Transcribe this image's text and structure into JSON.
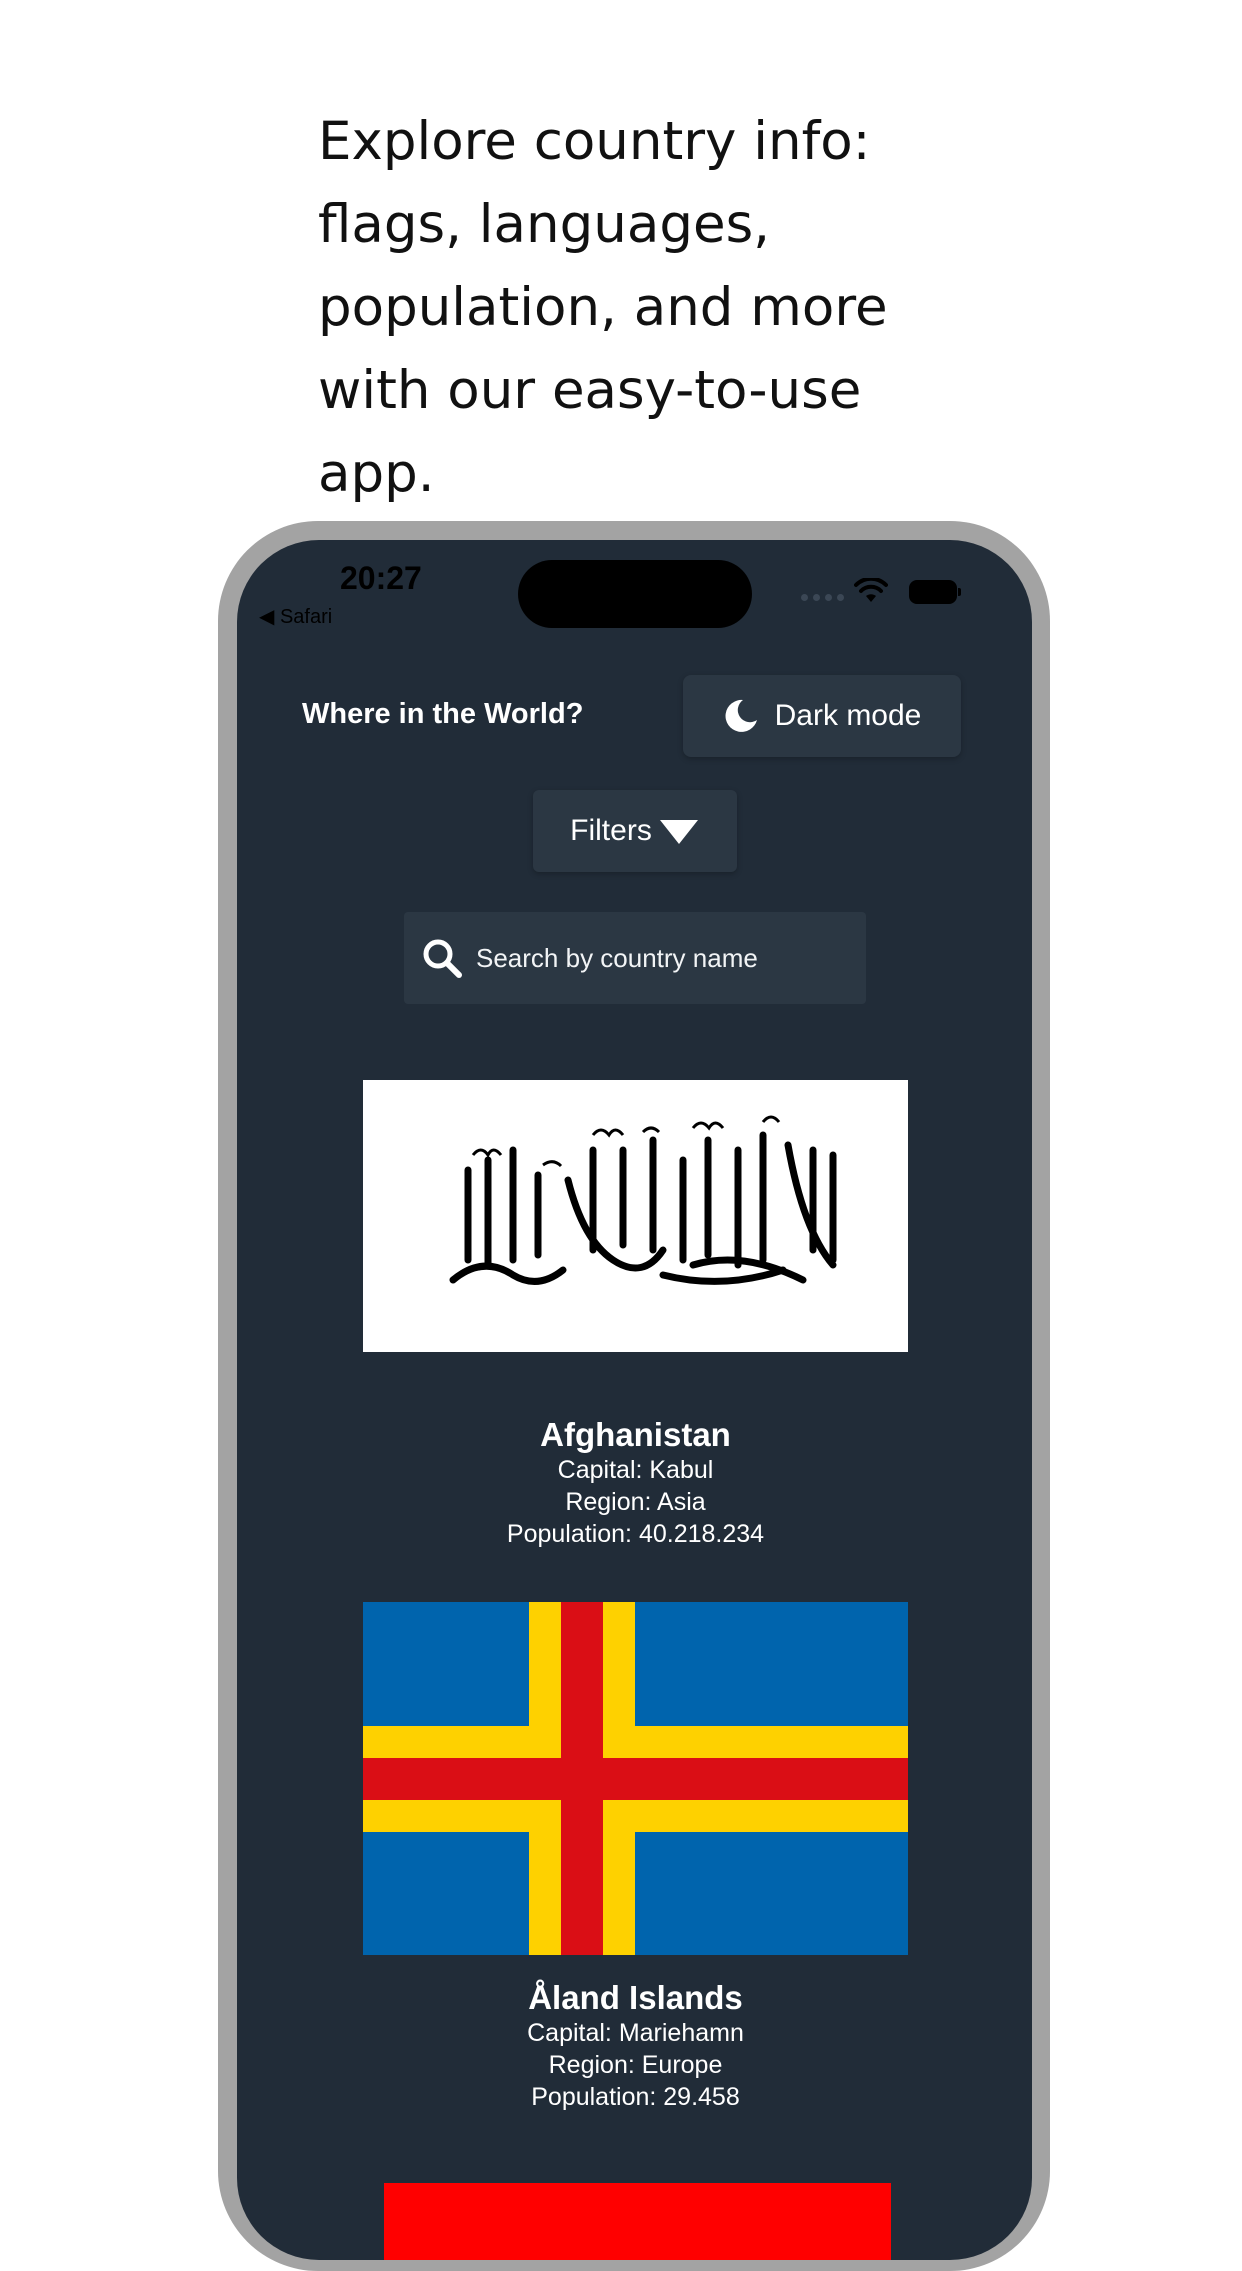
{
  "promo": {
    "headline": "Explore country info: flags, languages, population, and more with our easy-to-use app."
  },
  "status_bar": {
    "time": "20:27",
    "back_label": "◀ Safari"
  },
  "header": {
    "title": "Where in the World?",
    "dark_mode_label": "Dark mode",
    "dark_mode_icon": "moon-icon"
  },
  "filters": {
    "label": "Filters",
    "icon": "caret-down-icon"
  },
  "search": {
    "placeholder": "Search by country name",
    "value": "",
    "icon": "search-icon"
  },
  "colors": {
    "screen_bg": "#212c38",
    "element_bg": "#2b3743",
    "text": "#ffffff",
    "frame": "#a3a3a3"
  },
  "countries": [
    {
      "name": "Afghanistan",
      "capital": "Capital: Kabul",
      "region": "Region: Asia",
      "population": "Population: 40.218.234"
    },
    {
      "name": "Åland Islands",
      "capital": "Capital: Mariehamn",
      "region": "Region: Europe",
      "population": "Population: 29.458"
    }
  ]
}
